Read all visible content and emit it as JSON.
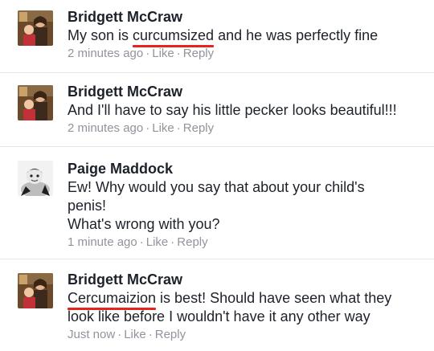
{
  "comments": [
    {
      "author": "Bridgett McCraw",
      "text_before": "My son is ",
      "text_marked": "curcumsized",
      "text_after": " and he was perfectly fine",
      "time": "2 minutes ago",
      "like_label": "Like",
      "reply_label": "Reply"
    },
    {
      "author": "Bridgett McCraw",
      "text": "And I'll have to say his little pecker looks beautiful!!!",
      "time": "2 minutes ago",
      "like_label": "Like",
      "reply_label": "Reply"
    },
    {
      "author": "Paige Maddock",
      "text_line1": "Ew! Why would you say that about your child's",
      "text_line2": "penis!",
      "text_line3": "What's wrong with you?",
      "time": "1 minute ago",
      "like_label": "Like",
      "reply_label": "Reply"
    },
    {
      "author": "Bridgett McCraw",
      "text_marked": "Cercumaizion",
      "text_after_line1": " is best! Should have seen what they",
      "text_line2": "look like before I wouldn't have it any other way",
      "time": "Just now",
      "like_label": "Like",
      "reply_label": "Reply"
    }
  ],
  "separator": "·",
  "colors": {
    "text": "#1d2129",
    "meta": "#90949c",
    "divider": "#e5e6ea",
    "underline_mark": "#e3251d"
  },
  "icons": {
    "bridgett_avatar": "photo-avatar",
    "paige_avatar": "photo-avatar-bw"
  }
}
